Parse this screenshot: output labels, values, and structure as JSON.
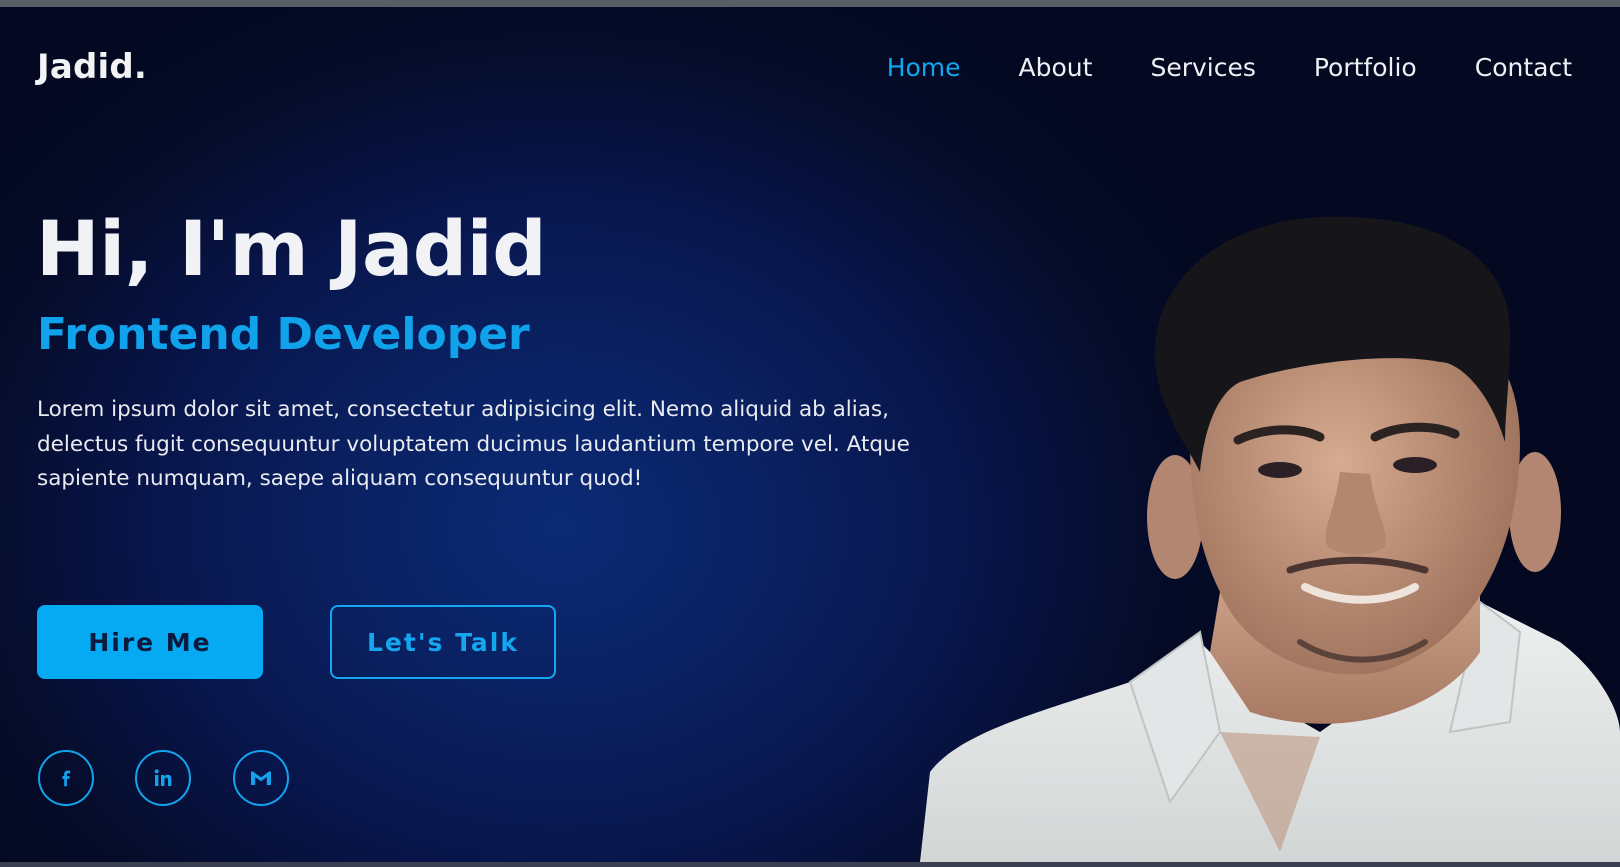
{
  "header": {
    "brand": "Jadid.",
    "nav": [
      {
        "label": "Home",
        "active": true
      },
      {
        "label": "About",
        "active": false
      },
      {
        "label": "Services",
        "active": false
      },
      {
        "label": "Portfolio",
        "active": false
      },
      {
        "label": "Contact",
        "active": false
      }
    ]
  },
  "hero": {
    "title": "Hi, I'm Jadid",
    "role": "Frontend Developer",
    "description": "Lorem ipsum dolor sit amet, consectetur adipisicing elit. Nemo aliquid ab alias, delectus fugit consequuntur voluptatem ducimus laudantium tempore vel. Atque sapiente numquam, saepe aliquam consequuntur quod!",
    "buttons": {
      "primary": "Hire Me",
      "secondary": "Let's Talk"
    }
  },
  "social": [
    {
      "icon": "facebook-icon"
    },
    {
      "icon": "linkedin-icon"
    },
    {
      "icon": "gmail-icon"
    }
  ],
  "colors": {
    "accent": "#11a7ee",
    "background": "#08154a",
    "text": "#f1f2f6"
  }
}
